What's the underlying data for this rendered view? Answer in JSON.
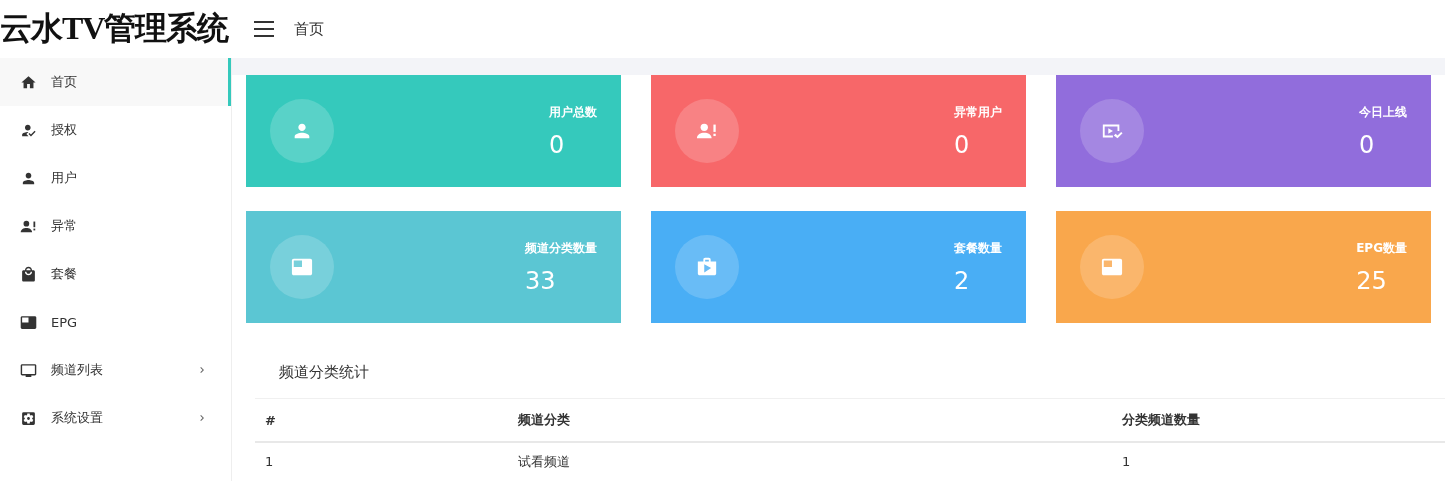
{
  "logo": "云水TV管理系统",
  "header": {
    "breadcrumb": "首页"
  },
  "sidebar": {
    "items": [
      {
        "label": "首页",
        "selected": true,
        "kind": "link"
      },
      {
        "label": "授权",
        "selected": false,
        "kind": "link"
      },
      {
        "label": "用户",
        "selected": false,
        "kind": "link"
      },
      {
        "label": "异常",
        "selected": false,
        "kind": "link"
      },
      {
        "label": "套餐",
        "selected": false,
        "kind": "link"
      },
      {
        "label": "EPG",
        "selected": false,
        "kind": "link"
      },
      {
        "label": "频道列表",
        "selected": false,
        "kind": "group"
      },
      {
        "label": "系统设置",
        "selected": false,
        "kind": "group"
      }
    ]
  },
  "stats": [
    {
      "label": "用户总数",
      "value": "0",
      "color": "#35c9bc"
    },
    {
      "label": "异常用户",
      "value": "0",
      "color": "#f76769"
    },
    {
      "label": "今日上线",
      "value": "0",
      "color": "#916ddc"
    },
    {
      "label": "频道分类数量",
      "value": "33",
      "color": "#5bc6d3"
    },
    {
      "label": "套餐数量",
      "value": "2",
      "color": "#49aef5"
    },
    {
      "label": "EPG数量",
      "value": "25",
      "color": "#f9a74c"
    }
  ],
  "table": {
    "title": "频道分类统计",
    "columns": [
      "#",
      "频道分类",
      "分类频道数量"
    ],
    "rows": [
      [
        "1",
        "试看频道",
        "1"
      ]
    ]
  }
}
